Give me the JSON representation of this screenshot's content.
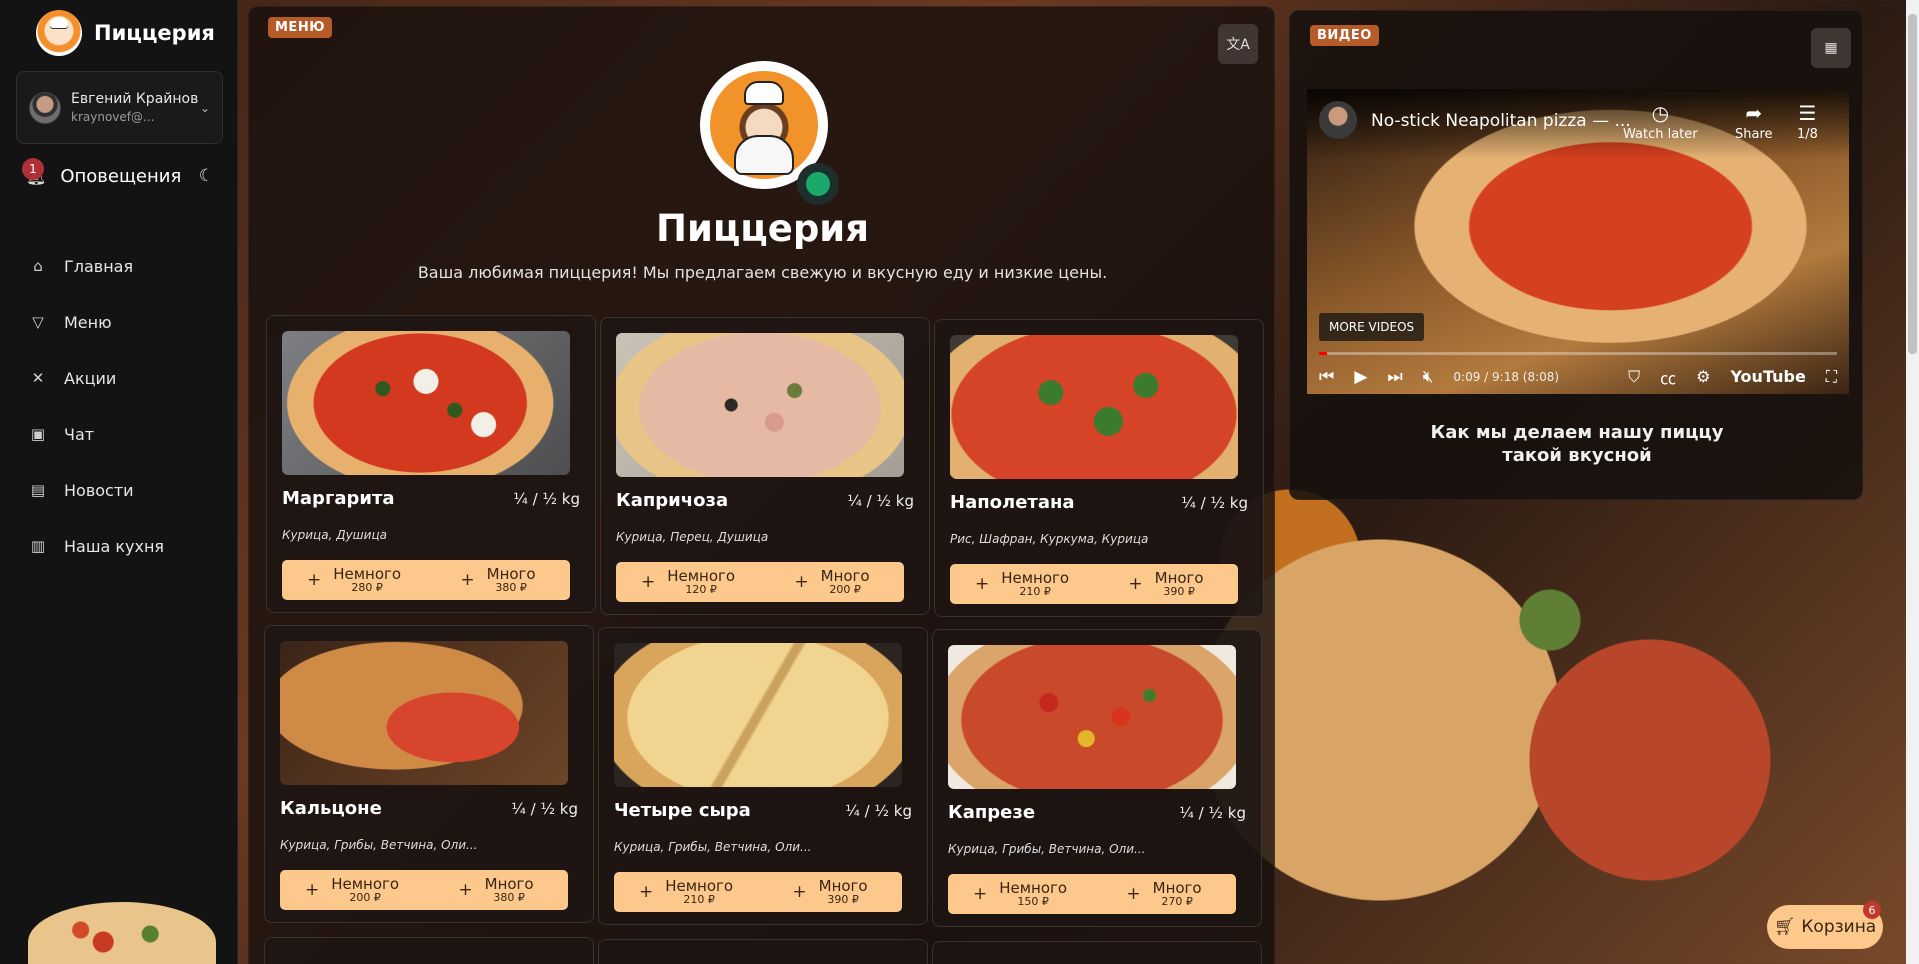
{
  "brand": {
    "name": "Пиццерия"
  },
  "user": {
    "name": "Евгений Крайнов",
    "email": "kraynovef@..."
  },
  "notifications": {
    "label": "Оповещения",
    "count": "1"
  },
  "nav": [
    {
      "label": "Главная",
      "icon": "home-icon"
    },
    {
      "label": "Меню",
      "icon": "pizza-icon"
    },
    {
      "label": "Акции",
      "icon": "tools-icon"
    },
    {
      "label": "Чат",
      "icon": "chat-icon"
    },
    {
      "label": "Новости",
      "icon": "newspaper-icon"
    },
    {
      "label": "Наша кухня",
      "icon": "kitchen-icon"
    }
  ],
  "menu_panel": {
    "tag": "МЕНЮ",
    "title": "Пиццерия",
    "subtitle": "Ваша любимая пиццерия! Мы предлагаем свежую и вкусную еду и низкие цены."
  },
  "pizzas": [
    {
      "name": "Маргарита",
      "size": "¼ / ½ kg",
      "ingredients": "Курица, Душица",
      "small_label": "Немного",
      "small_price": "280 ₽",
      "large_label": "Много",
      "large_price": "380 ₽"
    },
    {
      "name": "Капричоза",
      "size": "¼ / ½ kg",
      "ingredients": "Курица, Перец, Душица",
      "small_label": "Немного",
      "small_price": "120 ₽",
      "large_label": "Много",
      "large_price": "200 ₽"
    },
    {
      "name": "Наполетана",
      "size": "¼ / ½ kg",
      "ingredients": "Рис, Шафран, Куркума, Курица",
      "small_label": "Немного",
      "small_price": "210 ₽",
      "large_label": "Много",
      "large_price": "390 ₽"
    },
    {
      "name": "Кальцоне",
      "size": "¼ / ½ kg",
      "ingredients": "Курица, Грибы, Ветчина, Оли...",
      "small_label": "Немного",
      "small_price": "200 ₽",
      "large_label": "Много",
      "large_price": "380 ₽"
    },
    {
      "name": "Четыре сыра",
      "size": "¼ / ½ kg",
      "ingredients": "Курица, Грибы, Ветчина, Оли...",
      "small_label": "Немного",
      "small_price": "210 ₽",
      "large_label": "Много",
      "large_price": "390 ₽"
    },
    {
      "name": "Капрезе",
      "size": "¼ / ½ kg",
      "ingredients": "Курица, Грибы, Ветчина, Оли...",
      "small_label": "Немного",
      "small_price": "150 ₽",
      "large_label": "Много",
      "large_price": "270 ₽"
    }
  ],
  "video_panel": {
    "tag": "ВИДЕО",
    "video_title": "No-stick Neapolitan pizza — ...",
    "watch_later": "Watch later",
    "share": "Share",
    "playlist": "1/8",
    "more_videos": "MORE VIDEOS",
    "time": "0:09 / 9:18 (8:08)",
    "brand": "YouTube",
    "progress": 0.016,
    "caption_line1": "Как мы делаем нашу пиццу",
    "caption_line2": "такой вкусной"
  },
  "cart": {
    "label": "Корзина",
    "count": "6"
  }
}
